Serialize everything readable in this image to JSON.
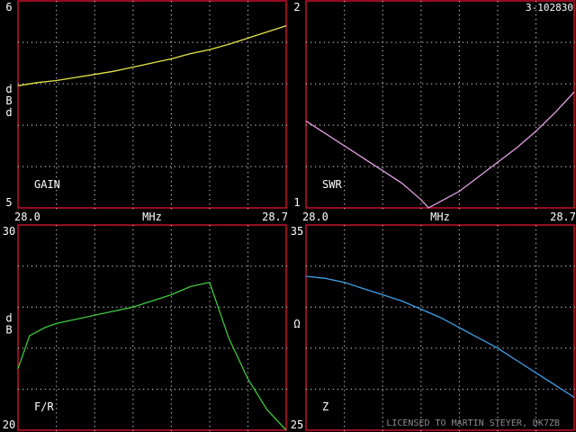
{
  "header": {
    "id_label": "3-102830"
  },
  "footer": {
    "license": "LICENSED TO MARTIN STEYER, DK7ZB"
  },
  "colors": {
    "frame": "#c8102e",
    "grid": "#bfbfbf",
    "text": "#ffffff"
  },
  "chart_data": [
    {
      "type": "line",
      "panel_label": "GAIN",
      "y_top_label": "6",
      "y_bottom_label": "5",
      "y_unit_letters": [
        "d",
        "B",
        "d"
      ],
      "x_left_label": "28.0",
      "x_mid_label": "MHz",
      "x_right_label": "28.7",
      "xlim": [
        28.0,
        28.7
      ],
      "ylim": [
        5,
        6
      ],
      "grid": true,
      "color": "#e6e64a",
      "x": [
        28.0,
        28.05,
        28.1,
        28.15,
        28.2,
        28.25,
        28.3,
        28.35,
        28.4,
        28.45,
        28.5,
        28.55,
        28.6,
        28.65,
        28.7
      ],
      "y": [
        5.59,
        5.605,
        5.615,
        5.63,
        5.645,
        5.66,
        5.68,
        5.7,
        5.72,
        5.745,
        5.765,
        5.79,
        5.82,
        5.85,
        5.88
      ]
    },
    {
      "type": "line",
      "panel_label": "SWR",
      "y_top_label": "2",
      "y_bottom_label": "1",
      "x_left_label": "28.0",
      "x_mid_label": "MHz",
      "x_right_label": "28.7",
      "xlim": [
        28.0,
        28.7
      ],
      "ylim": [
        1,
        2
      ],
      "grid": true,
      "color": "#e3a0e3",
      "x": [
        28.0,
        28.05,
        28.1,
        28.15,
        28.2,
        28.25,
        28.3,
        28.32,
        28.35,
        28.4,
        28.45,
        28.5,
        28.55,
        28.6,
        28.65,
        28.7
      ],
      "y": [
        1.42,
        1.36,
        1.3,
        1.24,
        1.18,
        1.12,
        1.04,
        1.0,
        1.03,
        1.08,
        1.15,
        1.22,
        1.29,
        1.37,
        1.46,
        1.56
      ]
    },
    {
      "type": "line",
      "panel_label": "F/R",
      "y_top_label": "30",
      "y_bottom_label": "20",
      "y_unit_letters": [
        "d",
        "B"
      ],
      "xlim": [
        28.0,
        28.7
      ],
      "ylim": [
        20,
        30
      ],
      "grid": true,
      "color": "#3ec83e",
      "x": [
        28.0,
        28.03,
        28.07,
        28.1,
        28.15,
        28.2,
        28.25,
        28.3,
        28.35,
        28.4,
        28.45,
        28.5,
        28.55,
        28.6,
        28.65,
        28.7
      ],
      "y": [
        23.0,
        24.6,
        25.0,
        25.2,
        25.4,
        25.6,
        25.8,
        26.0,
        26.3,
        26.6,
        27.0,
        27.2,
        24.5,
        22.5,
        21.0,
        20.0
      ]
    },
    {
      "type": "line",
      "panel_label": "Z",
      "y_top_label": "35",
      "y_bottom_label": "25",
      "y_unit_letters": [
        "Ω"
      ],
      "xlim": [
        28.0,
        28.7
      ],
      "ylim": [
        25,
        35
      ],
      "grid": true,
      "color": "#3fa0e6",
      "x": [
        28.0,
        28.05,
        28.1,
        28.15,
        28.2,
        28.25,
        28.3,
        28.35,
        28.4,
        28.45,
        28.5,
        28.55,
        28.6,
        28.65,
        28.7
      ],
      "y": [
        32.5,
        32.4,
        32.2,
        31.9,
        31.6,
        31.3,
        30.9,
        30.5,
        30.0,
        29.5,
        29.0,
        28.4,
        27.8,
        27.2,
        26.6
      ]
    }
  ]
}
